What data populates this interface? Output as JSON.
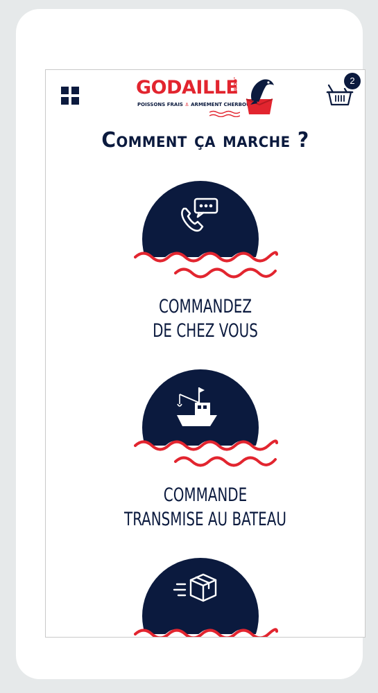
{
  "header": {
    "brand": "GODAILLE",
    "brand_suffix": ".com",
    "tagline_left": "POISSONS FRAIS",
    "tagline_right": "ARMEMENT CHERBOURGEOIS",
    "cart_count": "2"
  },
  "page": {
    "title": "Comment ça marche ?"
  },
  "steps": [
    {
      "line1": "COMMANDEZ",
      "line2": "DE CHEZ VOUS",
      "icon": "phone-chat-icon"
    },
    {
      "line1": "COMMANDE",
      "line2": "TRANSMISE AU BATEAU",
      "icon": "fishing-boat-icon"
    },
    {
      "line1": "",
      "line2": "",
      "icon": "delivery-box-icon"
    }
  ],
  "colors": {
    "navy": "#0b1a3e",
    "red": "#e2252f",
    "background": "#e6e9ea"
  }
}
